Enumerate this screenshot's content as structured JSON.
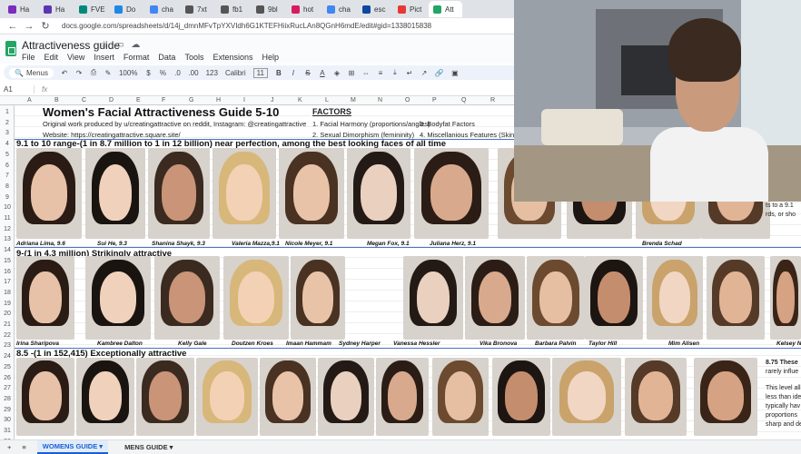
{
  "browser": {
    "tabs": [
      {
        "label": "Ha",
        "color": "#7b2cbf"
      },
      {
        "label": "Ha",
        "color": "#5e35b1"
      },
      {
        "label": "FVE",
        "color": "#00897b"
      },
      {
        "label": "Do",
        "color": "#1e88e5"
      },
      {
        "label": "cha",
        "color": "#4285f4"
      },
      {
        "label": "7xt",
        "color": "#555555"
      },
      {
        "label": "fb1",
        "color": "#555555"
      },
      {
        "label": "9bl",
        "color": "#555555"
      },
      {
        "label": "hot",
        "color": "#d81b60"
      },
      {
        "label": "cha",
        "color": "#4285f4"
      },
      {
        "label": "esc",
        "color": "#0d47a1"
      },
      {
        "label": "Pict",
        "color": "#e53935"
      },
      {
        "label": "Att",
        "color": "#23a566"
      }
    ],
    "url": "docs.google.com/spreadsheets/d/14j_dmnMFvTpYXVIdh6G1KTEFHiixRucLAn8QGnH6mdE/edit#gid=1338015838"
  },
  "sheets": {
    "title": "Attractiveness guide",
    "menu": [
      "File",
      "Edit",
      "View",
      "Insert",
      "Format",
      "Data",
      "Tools",
      "Extensions",
      "Help"
    ],
    "toolbar": {
      "search": "Menus",
      "zoom": "100%",
      "currency": "$",
      "percent": "%",
      "decimals_dec": ".0",
      "decimals_inc": ".00",
      "format_123": "123",
      "font": "Calibri",
      "font_size": "11",
      "bold": "B",
      "italic": "I",
      "strike": "S",
      "text_color": "A"
    },
    "namebox": "A1",
    "fx": "fx"
  },
  "columns": [
    "A",
    "B",
    "C",
    "D",
    "E",
    "F",
    "G",
    "H",
    "I",
    "J",
    "K",
    "L",
    "M",
    "N",
    "O",
    "P",
    "Q",
    "R"
  ],
  "rows": [
    "1",
    "2",
    "3",
    "4",
    "5",
    "6",
    "7",
    "8",
    "9",
    "10",
    "11",
    "12",
    "13",
    "14",
    "15",
    "16",
    "17",
    "18",
    "19",
    "20",
    "21",
    "22",
    "23",
    "24",
    "25",
    "26",
    "27",
    "28",
    "29",
    "30",
    "31",
    "32"
  ],
  "content": {
    "title": "Women's Facial Attractiveness Guide 5-10",
    "credit": "Original work produced by u/creatingattractive on reddit, Instagram: @creatingattractive",
    "website": "Website: https://creatingattractive.square.site/",
    "factors_head": "FACTORS",
    "factor1": "1. Facial Harmony (proportions/angles)",
    "factor2": "2. Sexual Dimorphism (femininity)",
    "factor3": "3. Bodyfat Factors",
    "factor4": "4. Miscellanious Features (Skin health",
    "section1": "9.1 to 10 range-(1 in 8.7 million to 1 in 12 billion) near perfection, among the best looking faces of all time",
    "section2": "9-(1 in 4.3 million) Strikingly attractive",
    "section3": "8.5 -(1 in 152,415) Exceptionally attractive",
    "names1": [
      "Adriana Lima, 9.6",
      "Sui He, 9.3",
      "Shanina Shayk, 9.3",
      "Valeria Mazza,9.1",
      "Nicole Meyer, 9.1",
      "Megan Fox, 9.1",
      "Juliana Herz, 9.1",
      "Brenda Schad"
    ],
    "names2": [
      "Irina Sharipova",
      "Kambree Dalton",
      "Kelly Gale",
      "Doutzen Kroes",
      "Imaan Hammam",
      "Sydney Harper",
      "Vanessa Hessler",
      "Vika Bronova",
      "Barbara Palvin",
      "Taylor Hill",
      "Mim Alisen",
      "Kelsey N"
    ],
    "side_note1": "ts to a 9.1",
    "side_note2": "rds, or sho",
    "notes3": [
      "8.75  These",
      "rarely influe",
      "This level all",
      "less than ide",
      "typically hav",
      "proportions",
      "sharp and de"
    ]
  },
  "sheet_tabs": {
    "add": "+",
    "all_sheets": "≡",
    "tab1": "WOMENS GUIDE",
    "tab2": "MENS GUIDE",
    "arrow": "▾"
  }
}
